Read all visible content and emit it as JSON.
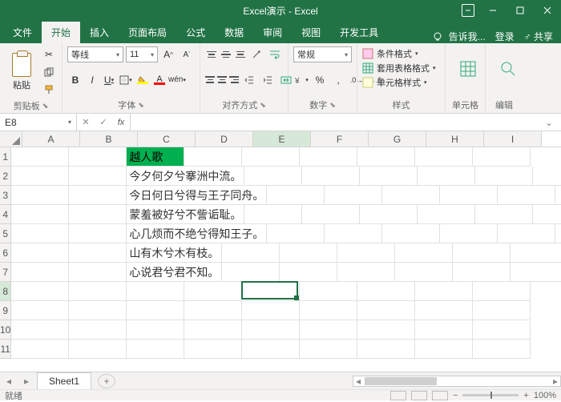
{
  "window": {
    "title": "Excel演示 - Excel"
  },
  "tabs": {
    "items": [
      "文件",
      "开始",
      "插入",
      "页面布局",
      "公式",
      "数据",
      "审阅",
      "视图",
      "开发工具"
    ],
    "active_index": 1,
    "tell_me": "告诉我...",
    "signin": "登录",
    "share": "共享"
  },
  "ribbon": {
    "clipboard": {
      "label": "剪贴板",
      "paste": "粘贴"
    },
    "font": {
      "label": "字体",
      "name": "等线",
      "size": "11",
      "wen": "wén"
    },
    "alignment": {
      "label": "对齐方式"
    },
    "number": {
      "label": "数字",
      "format": "常规"
    },
    "styles": {
      "label": "样式",
      "cond_format": "条件格式",
      "table_format": "套用表格格式",
      "cell_styles": "单元格样式"
    },
    "cells": {
      "label": "单元格"
    },
    "editing": {
      "label": "编辑"
    }
  },
  "fx": {
    "cell_ref": "E8",
    "formula": ""
  },
  "grid": {
    "columns": [
      "A",
      "B",
      "C",
      "D",
      "E",
      "F",
      "G",
      "H",
      "I"
    ],
    "row_count": 11,
    "active_col_index": 4,
    "active_row_index": 7,
    "data": {
      "1": {
        "C": "越人歌",
        "C_highlight": true
      },
      "2": {
        "C": "今夕何夕兮搴洲中流。"
      },
      "3": {
        "C": "今日何日兮得与王子同舟。"
      },
      "4": {
        "C": "蒙羞被好兮不訾诟耻。"
      },
      "5": {
        "C": "心几烦而不绝兮得知王子。"
      },
      "6": {
        "C": "山有木兮木有枝。"
      },
      "7": {
        "C": "心说君兮君不知。"
      }
    }
  },
  "sheets": {
    "active": "Sheet1"
  },
  "status": {
    "mode": "就绪",
    "zoom": "100%"
  }
}
